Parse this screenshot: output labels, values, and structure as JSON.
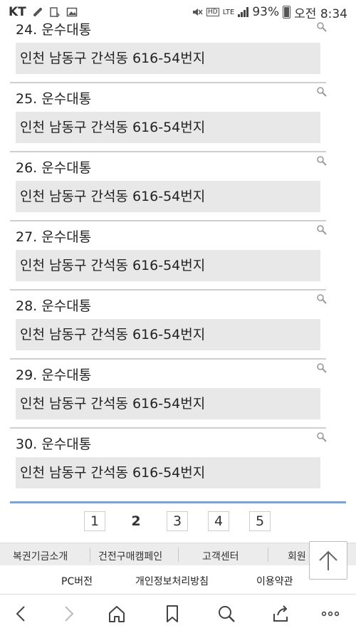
{
  "status_bar": {
    "carrier": "KT",
    "network": "LTE",
    "battery": "93%",
    "time": "오전 8:34"
  },
  "list_items": [
    {
      "name": "24. 운수대통",
      "address": "인천 남동구 간석동 616-54번지"
    },
    {
      "name": "25. 운수대통",
      "address": "인천 남동구 간석동 616-54번지"
    },
    {
      "name": "26. 운수대통",
      "address": "인천 남동구 간석동 616-54번지"
    },
    {
      "name": "27. 운수대통",
      "address": "인천 남동구 간석동 616-54번지"
    },
    {
      "name": "28. 운수대통",
      "address": "인천 남동구 간석동 616-54번지"
    },
    {
      "name": "29. 운수대통",
      "address": "인천 남동구 간석동 616-54번지"
    },
    {
      "name": "30. 운수대통",
      "address": "인천 남동구 간석동 616-54번지"
    }
  ],
  "pagination": {
    "pages": [
      "1",
      "2",
      "3",
      "4",
      "5"
    ],
    "current": "2"
  },
  "footer_menu": [
    "복권기금소개",
    "건전구매캠페인",
    "고객센터",
    "회원"
  ],
  "footer_links": [
    "PC버전",
    "개인정보처리방침",
    "이용약관"
  ],
  "icons": {
    "search": "search-icon",
    "top": "arrow-up-icon",
    "nav": [
      "back-icon",
      "forward-icon",
      "home-icon",
      "bookmark-icon",
      "search-icon",
      "share-icon",
      "more-icon"
    ]
  },
  "colors": {
    "accent_bar": "#7ea3cf",
    "address_bg": "#e8e8e8",
    "footer_bg": "#ececec"
  }
}
